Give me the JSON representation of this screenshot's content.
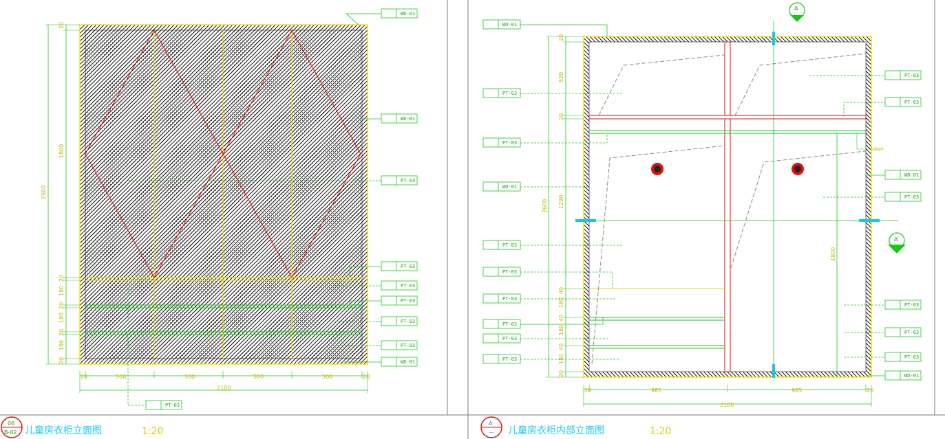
{
  "left_view": {
    "title": "儿童房衣柜立面图",
    "scale": "1:20",
    "marker_top": "06",
    "marker_bottom": "B-02",
    "labels": [
      "WD-01",
      "WD-01",
      "PT-03",
      "PT-03",
      "PT-03",
      "PT-03",
      "PT-03",
      "PT-03",
      "WD-01",
      "PT-03"
    ],
    "dims_bottom": [
      "20",
      "500",
      "500",
      "500",
      "500",
      "20"
    ],
    "dim_total": "2100",
    "dims_left": [
      "20",
      "1800",
      "20",
      "180",
      "20",
      "180",
      "20",
      "180",
      "20"
    ],
    "dim_left_total": "2600"
  },
  "right_view": {
    "title": "儿童房衣柜内部立面图",
    "scale": "1:20",
    "marker_top": "A",
    "marker_bottom": "—",
    "labels_left": [
      "WD-01",
      "PT-03",
      "PT-03",
      "WD-01",
      "PT-03",
      "PT-03",
      "PT-03",
      "PT-03",
      "PT-03",
      "PT-03"
    ],
    "labels_right": [
      "PT-03",
      "PT-03",
      "WD-01",
      "PT-03",
      "PT-03",
      "PT-03",
      "PT-03",
      "WD-01"
    ],
    "dims_bottom": [
      "20",
      "985",
      "985",
      "20"
    ],
    "dim_total": "2100",
    "dims_left": [
      "20",
      "520",
      "20",
      "1290",
      "40",
      "180",
      "40",
      "180",
      "40",
      "180",
      "20"
    ],
    "dim_left_total": "2600",
    "dim_right": "1800",
    "note": "衣通挂杆"
  }
}
